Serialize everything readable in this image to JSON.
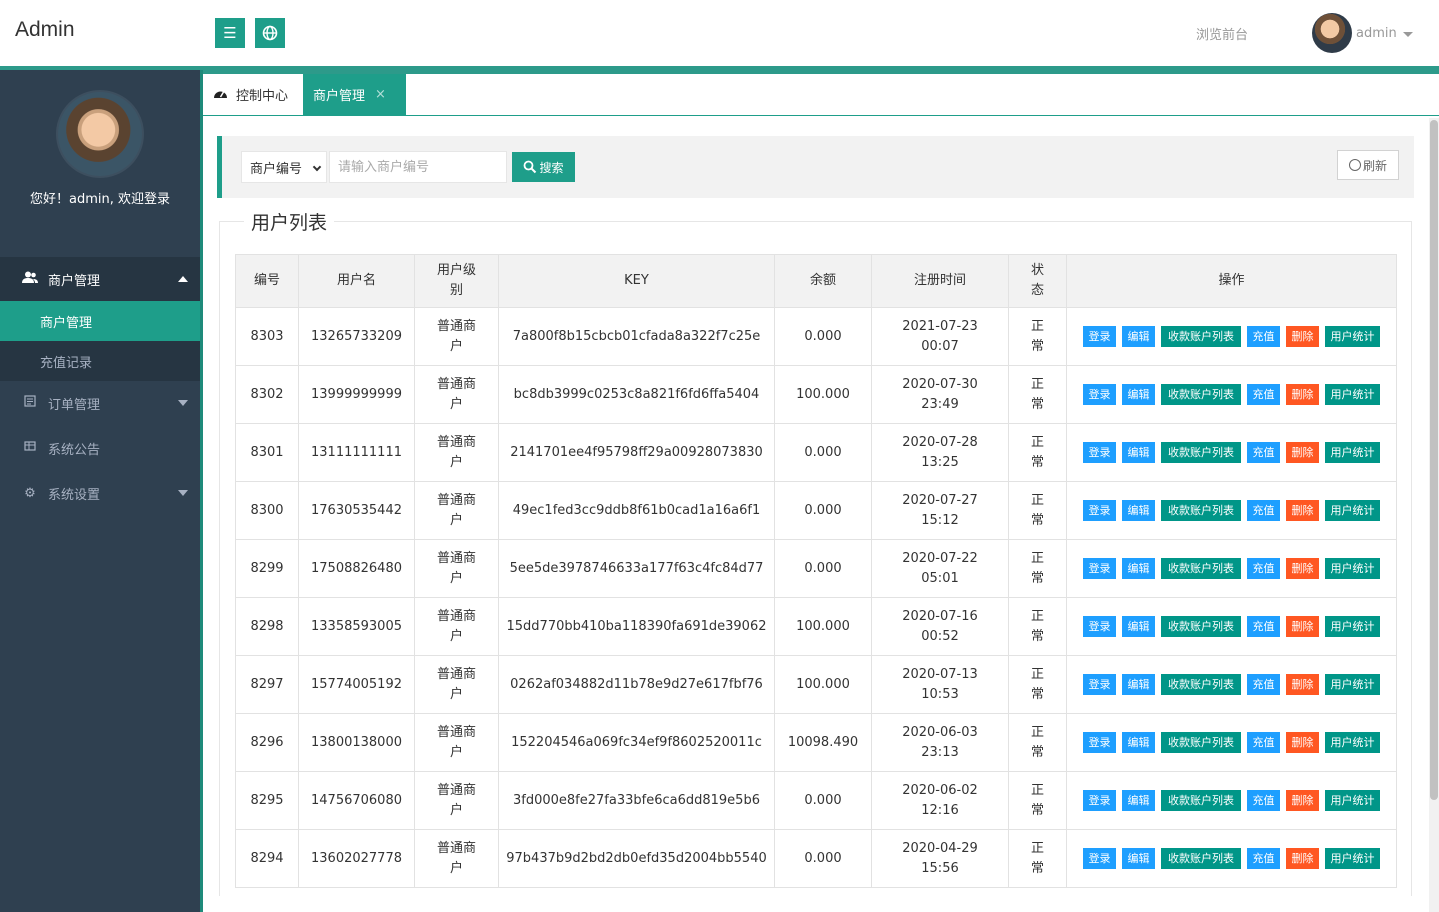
{
  "header": {
    "logo": "Admin",
    "menu_toggle_icon": "menu-icon",
    "site_icon": "globe-icon",
    "front_link": "浏览前台",
    "user_name": "admin"
  },
  "sidebar": {
    "welcome": "您好！admin, 欢迎登录",
    "groups": [
      {
        "label": "商户管理",
        "icon": "users-icon"
      },
      {
        "label": "订单管理",
        "icon": "list-icon"
      },
      {
        "label": "系统公告",
        "icon": "grid-icon"
      },
      {
        "label": "系统设置",
        "icon": "cogs-icon"
      }
    ],
    "sub_items": [
      "商户管理",
      "充值记录"
    ]
  },
  "tabs": {
    "home": "控制中心",
    "current": "商户管理",
    "close": "×"
  },
  "search": {
    "select_value": "商户编号",
    "placeholder": "请输入商户编号",
    "search_label": "搜索",
    "refresh_label": "刷新"
  },
  "section_title": "用户列表",
  "table": {
    "headers": [
      "编号",
      "用户名",
      "用户级别",
      "KEY",
      "余额",
      "注册时间",
      "状态",
      "操作"
    ],
    "actions": {
      "login": "登录",
      "edit": "编辑",
      "accounts": "收款账户列表",
      "recharge": "充值",
      "delete": "删除",
      "stats": "用户统计"
    },
    "rows": [
      {
        "id": "8303",
        "username": "13265733209",
        "level": "普通商户",
        "key": "7a800f8b15cbcb01cfada8a322f7c25e",
        "balance": "0.000",
        "date": "2021-07-23",
        "time": "00:07",
        "status": "正常"
      },
      {
        "id": "8302",
        "username": "13999999999",
        "level": "普通商户",
        "key": "bc8db3999c0253c8a821f6fd6ffa5404",
        "balance": "100.000",
        "date": "2020-07-30",
        "time": "23:49",
        "status": "正常"
      },
      {
        "id": "8301",
        "username": "13111111111",
        "level": "普通商户",
        "key": "2141701ee4f95798ff29a00928073830",
        "balance": "0.000",
        "date": "2020-07-28",
        "time": "13:25",
        "status": "正常"
      },
      {
        "id": "8300",
        "username": "17630535442",
        "level": "普通商户",
        "key": "49ec1fed3cc9ddb8f61b0cad1a16a6f1",
        "balance": "0.000",
        "date": "2020-07-27",
        "time": "15:12",
        "status": "正常"
      },
      {
        "id": "8299",
        "username": "17508826480",
        "level": "普通商户",
        "key": "5ee5de3978746633a177f63c4fc84d77",
        "balance": "0.000",
        "date": "2020-07-22",
        "time": "05:01",
        "status": "正常"
      },
      {
        "id": "8298",
        "username": "13358593005",
        "level": "普通商户",
        "key": "15dd770bb410ba118390fa691de39062",
        "balance": "100.000",
        "date": "2020-07-16",
        "time": "00:52",
        "status": "正常"
      },
      {
        "id": "8297",
        "username": "15774005192",
        "level": "普通商户",
        "key": "0262af034882d11b78e9d27e617fbf76",
        "balance": "100.000",
        "date": "2020-07-13",
        "time": "10:53",
        "status": "正常"
      },
      {
        "id": "8296",
        "username": "13800138000",
        "level": "普通商户",
        "key": "152204546a069fc34ef9f8602520011c",
        "balance": "10098.490",
        "date": "2020-06-03",
        "time": "23:13",
        "status": "正常"
      },
      {
        "id": "8295",
        "username": "14756706080",
        "level": "普通商户",
        "key": "3fd000e8fe27fa33bfe6ca6dd819e5b6",
        "balance": "0.000",
        "date": "2020-06-02",
        "time": "12:16",
        "status": "正常"
      },
      {
        "id": "8294",
        "username": "13602027778",
        "level": "普通商户",
        "key": "97b437b9d2bd2db0efd35d2004bb5540",
        "balance": "0.000",
        "date": "2020-04-29",
        "time": "15:56",
        "status": "正常"
      }
    ]
  },
  "colors": {
    "accent": "#1e9e8a",
    "sidebar": "#2f4050",
    "blue": "#1e9fff",
    "orange": "#ff5722"
  }
}
